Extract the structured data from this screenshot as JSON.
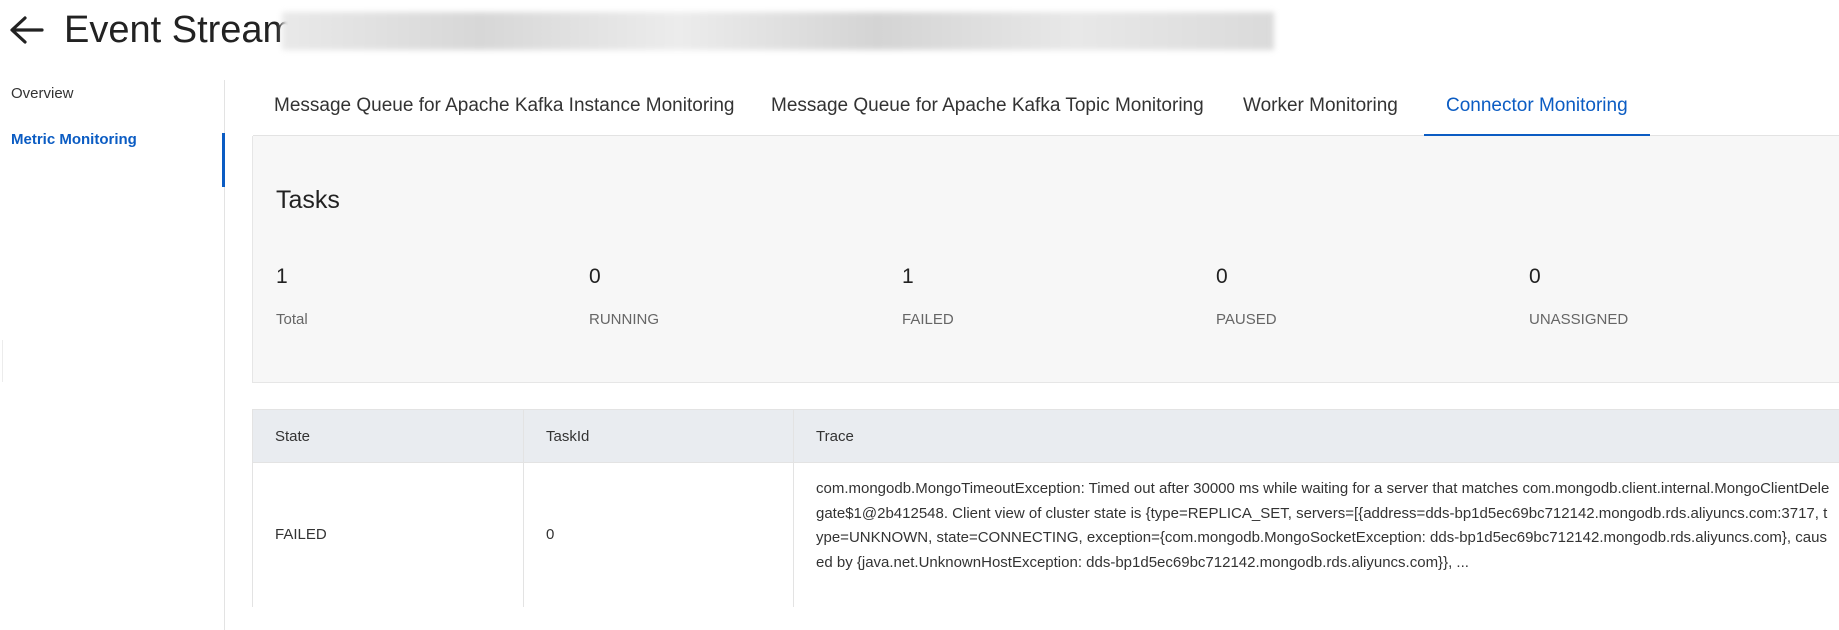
{
  "header": {
    "back_icon": "arrow-left-icon",
    "title": "Event Stream"
  },
  "sidebar": {
    "items": [
      {
        "label": "Overview",
        "active": false
      },
      {
        "label": "Metric Monitoring",
        "active": true
      }
    ]
  },
  "tabs": [
    {
      "label": "Message Queue for Apache Kafka Instance Monitoring",
      "active": false
    },
    {
      "label": "Message Queue for Apache Kafka Topic Monitoring",
      "active": false
    },
    {
      "label": "Worker Monitoring",
      "active": false
    },
    {
      "label": "Connector Monitoring",
      "active": true
    }
  ],
  "tasks": {
    "title": "Tasks",
    "stats": [
      {
        "value": "1",
        "label": "Total"
      },
      {
        "value": "0",
        "label": "RUNNING"
      },
      {
        "value": "1",
        "label": "FAILED"
      },
      {
        "value": "0",
        "label": "PAUSED"
      },
      {
        "value": "0",
        "label": "UNASSIGNED"
      }
    ]
  },
  "table": {
    "columns": [
      "State",
      "TaskId",
      "Trace"
    ],
    "rows": [
      {
        "state": "FAILED",
        "task_id": "0",
        "trace": "com.mongodb.MongoTimeoutException: Timed out after 30000 ms while waiting for a server that matches com.mongodb.client.internal.MongoClientDelegate$1@2b412548. Client view of cluster state is {type=REPLICA_SET, servers=[{address=dds-bp1d5ec69bc712142.mongodb.rds.aliyuncs.com:3717, type=UNKNOWN, state=CONNECTING, exception={com.mongodb.MongoSocketException: dds-bp1d5ec69bc712142.mongodb.rds.aliyuncs.com}, caused by {java.net.UnknownHostException: dds-bp1d5ec69bc712142.mongodb.rds.aliyuncs.com}}, ..."
      }
    ]
  },
  "colors": {
    "accent": "#0b5cc3",
    "panel_bg": "#f7f7f7",
    "table_header_bg": "#e9ecf0"
  }
}
